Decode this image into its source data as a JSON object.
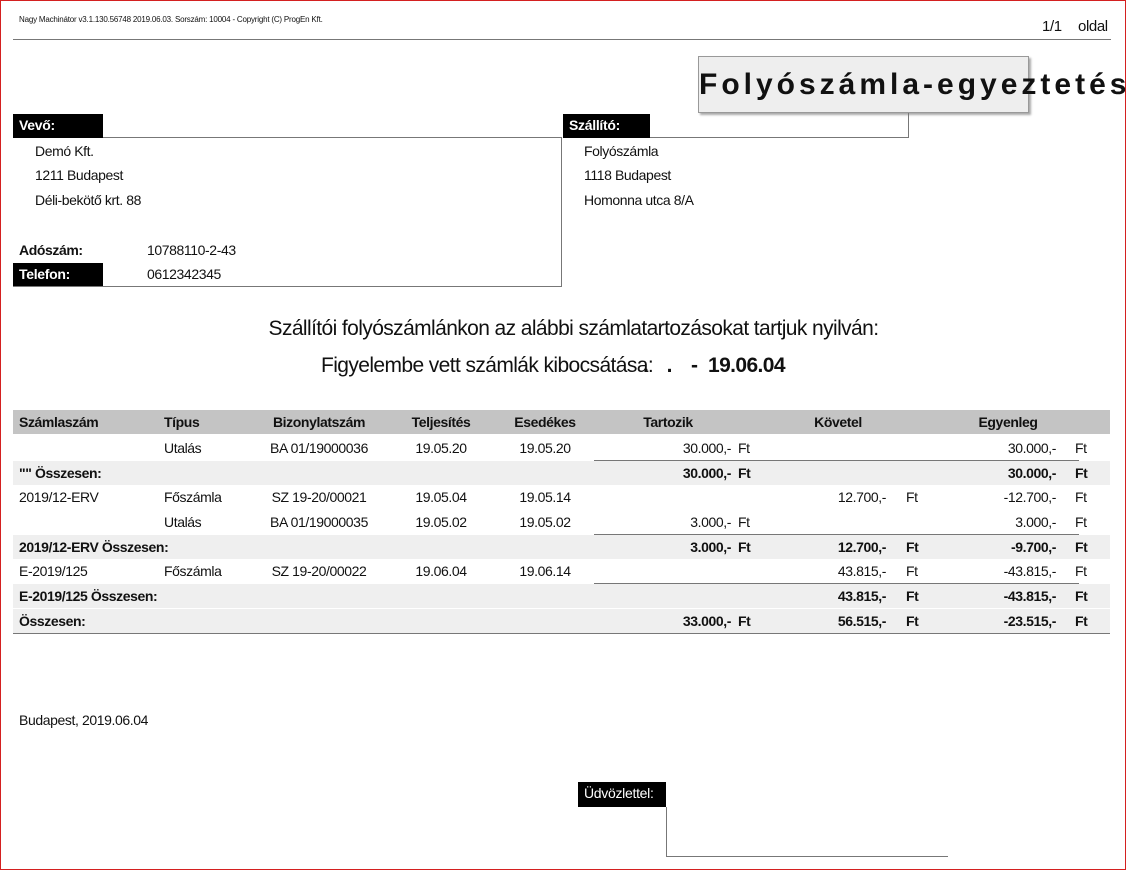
{
  "header": {
    "program_info": "Nagy Machinátor v3.1.130.56748 2019.06.03. Sorszám: 10004 - Copyright (C) ProgEn Kft.",
    "page": "1/1",
    "page_label": "oldal"
  },
  "title": "Folyószámla-egyeztetés",
  "buyer": {
    "label": "Vevő:",
    "name": "Demó Kft.",
    "city": "1211 Budapest",
    "street": "Déli-bekötő krt. 88",
    "tax_label": "Adószám:",
    "tax": "10788110-2-43",
    "phone_label": "Telefon:",
    "phone": "0612342345"
  },
  "supplier": {
    "label": "Szállító:",
    "name": "Folyószámla",
    "city": "1118 Budapest",
    "street": "Homonna utca 8/A"
  },
  "intro": {
    "line1": "Szállítói folyószámlánkon az alábbi számlatartozásokat tartjuk nyilván:",
    "line2_label": "Figyelembe vett számlák kibocsátása:",
    "date_from": ". .",
    "dash": "-",
    "date_to": "19.06.04"
  },
  "table": {
    "headers": [
      "Számlaszám",
      "Típus",
      "Bizonylatszám",
      "Teljesítés",
      "Esedékes",
      "Tartozik",
      "Követel",
      "Egyenleg"
    ],
    "currency": "Ft",
    "rows": [
      {
        "kind": "item",
        "invoice": "",
        "type": "Utalás",
        "doc": "BA 01/19000036",
        "perf": "19.05.20",
        "due": "19.05.20",
        "debit": "30.000,-",
        "credit": "",
        "balance": "30.000,-"
      },
      {
        "kind": "sum",
        "invoice": "\"\" Összesen:",
        "debit": "30.000,-",
        "credit": "",
        "balance": "30.000,-"
      },
      {
        "kind": "item",
        "invoice": "2019/12-ERV",
        "type": "Főszámla",
        "doc": "SZ 19-20/00021",
        "perf": "19.05.04",
        "due": "19.05.14",
        "debit": "",
        "credit": "12.700,-",
        "balance": "-12.700,-"
      },
      {
        "kind": "item",
        "invoice": "",
        "type": "Utalás",
        "doc": "BA 01/19000035",
        "perf": "19.05.02",
        "due": "19.05.02",
        "debit": "3.000,-",
        "credit": "",
        "balance": "3.000,-"
      },
      {
        "kind": "sum",
        "invoice": "2019/12-ERV Összesen:",
        "debit": "3.000,-",
        "credit": "12.700,-",
        "balance": "-9.700,-"
      },
      {
        "kind": "item",
        "invoice": "E-2019/125",
        "type": "Főszámla",
        "doc": "SZ 19-20/00022",
        "perf": "19.06.04",
        "due": "19.06.14",
        "debit": "",
        "credit": "43.815,-",
        "balance": "-43.815,-"
      },
      {
        "kind": "sum",
        "invoice": "E-2019/125 Összesen:",
        "debit": "",
        "credit": "43.815,-",
        "balance": "-43.815,-"
      },
      {
        "kind": "sum",
        "invoice": "Összesen:",
        "debit": "33.000,-",
        "credit": "56.515,-",
        "balance": "-23.515,-"
      }
    ]
  },
  "footer": {
    "place_date": "Budapest, 2019.06.04",
    "greeting": "Üdvözlettel:"
  }
}
